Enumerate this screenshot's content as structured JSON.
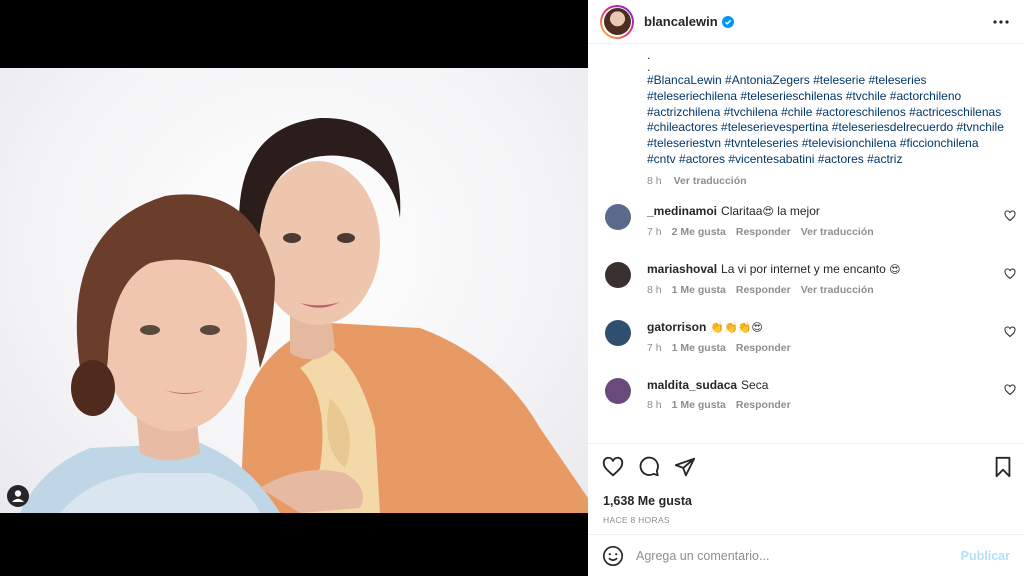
{
  "post": {
    "username": "blancalewin",
    "verified_icon": "verified-badge-icon",
    "more_icon": "more-options-icon"
  },
  "caption": {
    "dots": [
      ".",
      "."
    ],
    "hashtags": "#BlancaLewin #AntoniaZegers #teleserie #teleseries #teleseriechilena #teleserieschilenas #tvchile #actorchileno #actrizchilena #tvchilena #chile #actoreschilenos #actriceschilenas #chileactores #teleserievespertina #teleseriesdelrecuerdo #tvnchile #teleseriestvn #tvnteleseries #televisionchilena #ficcionchilena #cntv #actores #vicentesabatini #actores #actriz",
    "time": "8 h",
    "translate": "Ver traducción"
  },
  "comments": [
    {
      "user": "_medinamoi",
      "text": "Claritaa",
      "emoji": "😍",
      "text2": " la mejor",
      "time": "7 h",
      "likes": "2 Me gusta",
      "reply": "Responder",
      "translate": "Ver traducción",
      "avatar_color": "#5a6a8a"
    },
    {
      "user": "mariashoval",
      "text": "La vi por internet y me encanto ",
      "emoji": "😍",
      "text2": "",
      "time": "8 h",
      "likes": "1 Me gusta",
      "reply": "Responder",
      "translate": "Ver traducción",
      "avatar_color": "#3b3030"
    },
    {
      "user": "gatorrison",
      "text": "",
      "emoji": "👏👏👏😍",
      "text2": "",
      "time": "7 h",
      "likes": "1 Me gusta",
      "reply": "Responder",
      "translate": "",
      "avatar_color": "#2f4f6f"
    },
    {
      "user": "maldita_sudaca",
      "text": "Seca",
      "emoji": "",
      "text2": "",
      "time": "8 h",
      "likes": "1 Me gusta",
      "reply": "Responder",
      "translate": "",
      "avatar_color": "#6a4a7a"
    }
  ],
  "footer": {
    "likes": "1,638 Me gusta",
    "posted": "HACE 8 HORAS",
    "comment_placeholder": "Agrega un comentario...",
    "publish": "Publicar"
  },
  "colors": {
    "hashtag": "#00376b",
    "verified": "#0095f6",
    "publish_disabled": "#b2dffc",
    "secondary_text": "#8e8e8e"
  }
}
